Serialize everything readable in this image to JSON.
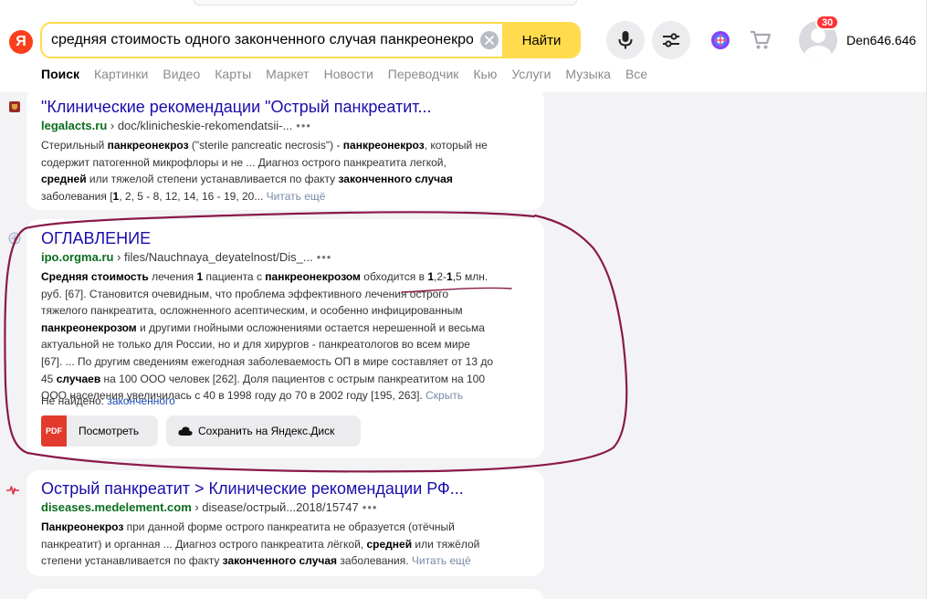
{
  "search": {
    "query": "средняя стоимость одного законченного случая панкреонекроза",
    "button_label": "Найти",
    "logo_letter": "Я"
  },
  "user": {
    "name": "Den646.646",
    "notifications": "30"
  },
  "tabs": [
    {
      "label": "Поиск",
      "active": true
    },
    {
      "label": "Картинки"
    },
    {
      "label": "Видео"
    },
    {
      "label": "Карты"
    },
    {
      "label": "Маркет"
    },
    {
      "label": "Новости"
    },
    {
      "label": "Переводчик"
    },
    {
      "label": "Кью"
    },
    {
      "label": "Услуги"
    },
    {
      "label": "Музыка"
    },
    {
      "label": "Все"
    }
  ],
  "results": [
    {
      "title": "\"Клинические рекомендации \"Острый панкреатит...",
      "host": "legalacts.ru",
      "path": " › doc/klinicheskie-rekomendatsii-...",
      "dots": "•••",
      "snippet_lines": [
        [
          "Стерильный ",
          "*панкреонекроз",
          " (\"sterile pancreatic necrosis\") - ",
          "*панкреонекроз",
          ", который не"
        ],
        [
          "содержит патогенной микрофлоры и не ... Диагноз острого панкреатита легкой,"
        ],
        [
          "*средней",
          " или тяжелой степени устанавливается по факту ",
          "*законченного случая"
        ],
        [
          "заболевания [",
          "*1",
          ", 2, 5 - 8, 12, 14, 16 - 19, 20... "
        ]
      ],
      "more": "Читать ещё"
    },
    {
      "title": "ОГЛАВЛЕНИЕ",
      "host": "ipo.orgma.ru",
      "path": " › files/Nauchnaya_deyatelnost/Dis_...",
      "dots": "•••",
      "snippet_lines": [
        [
          "*Средняя стоимость",
          " лечения ",
          "*1",
          " пациента с ",
          "*панкреонекрозом",
          " обходится в ",
          "*1",
          ",2-",
          "*1",
          ",5 млн."
        ],
        [
          "руб. [67]. Становится очевидным, что проблема эффективного лечения острого"
        ],
        [
          "тяжелого панкреатита, осложненного асептическим, и особенно инфицированным"
        ],
        [
          "*панкреонекрозом",
          " и другими гнойными осложнениями остается нерешенной и весьма"
        ],
        [
          "актуальной не только для России, но и для хирургов - панкреатологов во всем мире"
        ],
        [
          "[67]. ... По другим сведениям ежегодная заболеваемость ОП в мире составляет от 13 до"
        ],
        [
          "45 ",
          "*случаев",
          " на 100 ООО человек [262]. Доля пациентов с острым панкреатитом на 100"
        ],
        [
          "ООО населения увеличилась с 40 в 1998 году до 70 в 2002 году [195, 263]. "
        ]
      ],
      "more": "Скрыть",
      "not_found_label": "Не найдено: ",
      "not_found_term": "законченного",
      "pdf_chip": "PDF",
      "view_label": "Посмотреть",
      "save_label": "Сохранить на Яндекс.Диск"
    },
    {
      "title": "Острый панкреатит > Клинические рекомендации РФ...",
      "host": "diseases.medelement.com",
      "path": " › disease/острый...2018/15747",
      "dots": "•••",
      "snippet_lines": [
        [
          "*Панкреонекроз",
          " при данной форме острого панкреатита не образуется (отёчный"
        ],
        [
          "панкреатит) и органная ... Диагноз острого панкреатита лёгкой, ",
          "*средней",
          " или тяжёлой"
        ],
        [
          "степени устанавливается по факту ",
          "*законченного случая",
          " заболевания. "
        ]
      ],
      "more": "Читать ещё"
    }
  ],
  "colors": {
    "accent_yellow": "#ffdb4d",
    "link_blue": "#1a0dab",
    "url_green": "#0a6e1f",
    "annotation": "#8a1a4a",
    "logo_red": "#fc3f1d"
  }
}
